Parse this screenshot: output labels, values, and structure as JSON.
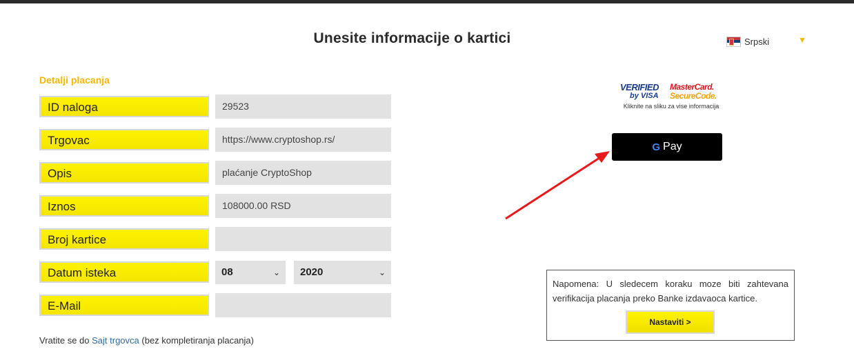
{
  "header": {
    "title": "Unesite informacije o kartici",
    "language": {
      "label": "Srpski",
      "flag_icon": "serbia-flag-icon",
      "dropdown_icon": "triangle-down-icon"
    }
  },
  "form": {
    "section_title": "Detalji placanja",
    "fields": [
      {
        "label": "ID naloga",
        "value": "29523"
      },
      {
        "label": "Trgovac",
        "value": "https://www.cryptoshop.rs/"
      },
      {
        "label": "Opis",
        "value": "plaćanje CryptoShop"
      },
      {
        "label": "Iznos",
        "value": "108000.00 RSD"
      },
      {
        "label": "Broj kartice",
        "value": ""
      },
      {
        "label": "Datum isteka",
        "month": "08",
        "year": "2020"
      },
      {
        "label": "E-Mail",
        "value": ""
      }
    ],
    "back_text_before": "Vratite se do ",
    "back_link": "Sajt trgovca",
    "back_text_after": " (bez kompletiranja placanja)"
  },
  "security": {
    "verified_line1": "VERIFIED",
    "verified_line2": "by VISA",
    "mastercard_line1": "MasterCard.",
    "mastercard_line2": "SecureCode.",
    "note": "Kliknite na sliku za vise informacija"
  },
  "gpay": {
    "g": "G",
    "label": "Pay"
  },
  "notice": {
    "text": "Napomena: U sledecem koraku moze biti zahtevana verifikacija placanja preko Banke izdavaoca kartice.",
    "button": "Nastaviti >"
  },
  "colors": {
    "accent_yellow": "#fff300",
    "section_title": "#f2b705",
    "field_bg": "#e2e2e2",
    "annotation_arrow": "#e8191b"
  }
}
